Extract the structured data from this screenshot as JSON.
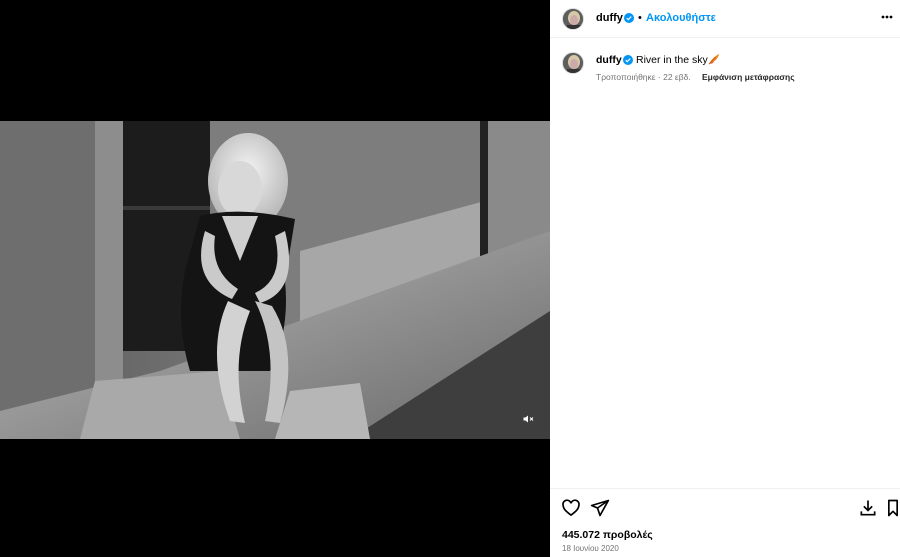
{
  "post": {
    "username": "duffy",
    "follow_label": "Ακολουθήστε",
    "separator": "•",
    "caption": "River in the sky",
    "caption_emoji": "orange-feather-emoji",
    "meta": "Τροποποιήθηκε · 22 εβδ.",
    "translate_label": "Εμφάνιση μετάφρασης",
    "likes": "445.072 προβολές",
    "date": "18 Ιουνίου 2020"
  },
  "icons": {
    "verified": "verified-badge-icon",
    "more": "more-options-icon",
    "like": "heart-icon",
    "share": "send-icon",
    "save": "download-icon",
    "bookmark": "bookmark-icon",
    "mute": "speaker-muted-icon"
  },
  "colors": {
    "accent": "#0095f6",
    "muted_text": "#737373",
    "media_bg": "#000000"
  }
}
